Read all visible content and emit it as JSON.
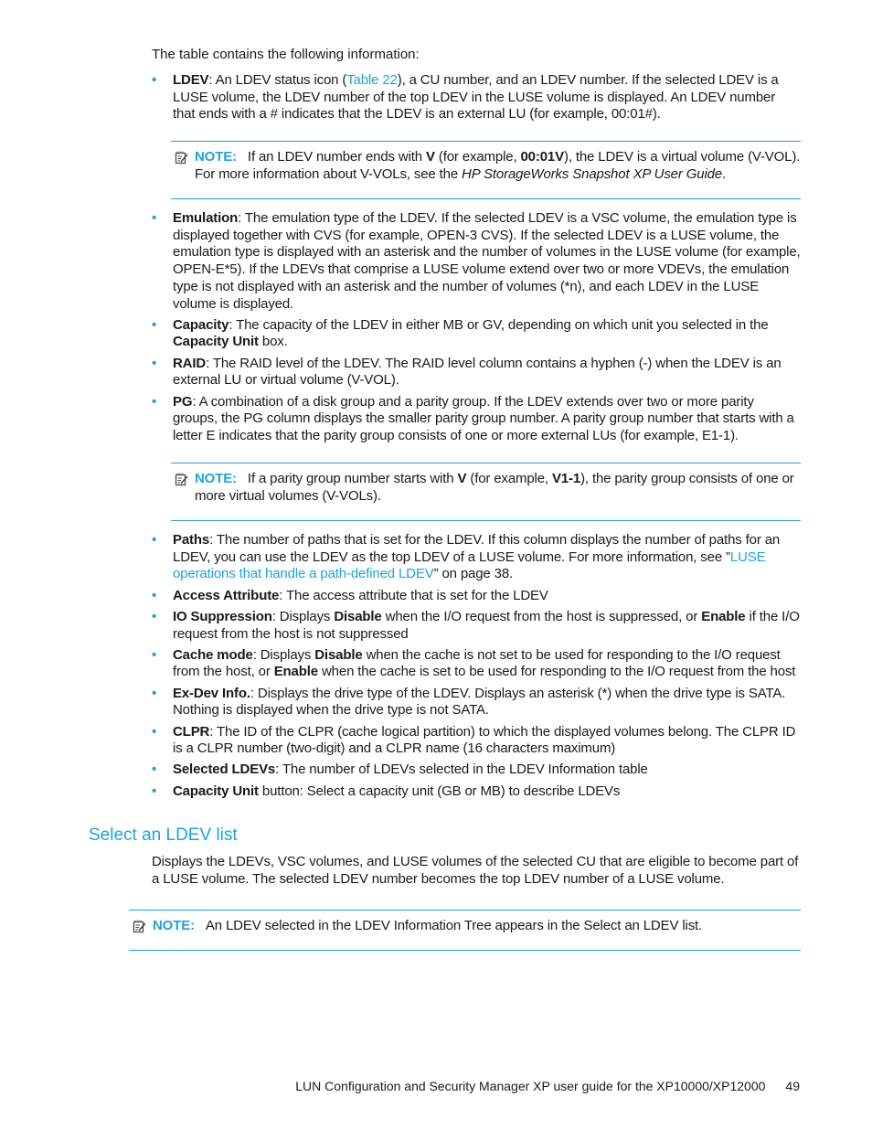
{
  "intro": "The table contains the following information:",
  "bullets_a": [
    {
      "term": "LDEV",
      "parts": [
        {
          "t": ": An LDEV status icon ("
        },
        {
          "t": "Table 22",
          "link": true
        },
        {
          "t": "), a CU number, and an LDEV number. If the selected LDEV is a LUSE volume, the LDEV number of the top LDEV in the LUSE volume is displayed. An LDEV number that ends with a # indicates that the LDEV is an external LU (for example, 00:01#)."
        }
      ]
    }
  ],
  "note1": {
    "label": "NOTE:",
    "parts": [
      {
        "t": "If an LDEV number ends with "
      },
      {
        "t": "V",
        "b": true
      },
      {
        "t": " (for example, "
      },
      {
        "t": "00:01V",
        "b": true
      },
      {
        "t": "), the LDEV is a virtual volume (V-VOL). For more information about V-VOLs, see the "
      },
      {
        "t": "HP StorageWorks Snapshot XP User Guide",
        "i": true
      },
      {
        "t": "."
      }
    ]
  },
  "bullets_b": [
    {
      "term": "Emulation",
      "parts": [
        {
          "t": ": The emulation type of the LDEV. If the selected LDEV is a VSC volume, the emulation type is displayed together with CVS (for example, OPEN-3 CVS). If the selected LDEV is a LUSE volume, the emulation type is displayed with an asterisk and the number of volumes in the LUSE volume (for example, OPEN-E*5). If the LDEVs that comprise a LUSE volume extend over two or more VDEVs, the emulation type is not displayed with an asterisk and the number of volumes (*n), and each LDEV in the LUSE volume is displayed."
        }
      ]
    },
    {
      "term": "Capacity",
      "parts": [
        {
          "t": ": The capacity of the LDEV in either MB or GV, depending on which unit you selected in the "
        },
        {
          "t": "Capacity Unit",
          "b": true
        },
        {
          "t": " box."
        }
      ]
    },
    {
      "term": "RAID",
      "parts": [
        {
          "t": ": The RAID level of the LDEV. The RAID level column contains a hyphen (-) when the LDEV is an external LU or virtual volume (V-VOL)."
        }
      ]
    },
    {
      "term": "PG",
      "parts": [
        {
          "t": ": A combination of a disk group and a parity group. If the LDEV extends over two or more parity groups, the PG column displays the smaller parity group number. A parity group number that starts with a letter E indicates that the parity group consists of one or more external LUs (for example, E1-1)."
        }
      ]
    }
  ],
  "note2": {
    "label": "NOTE:",
    "parts": [
      {
        "t": "If a parity group number starts with "
      },
      {
        "t": "V",
        "b": true
      },
      {
        "t": " (for example, "
      },
      {
        "t": "V1-1",
        "b": true
      },
      {
        "t": "), the parity group consists of one or more virtual volumes (V-VOLs)."
      }
    ]
  },
  "bullets_c": [
    {
      "term": "Paths",
      "parts": [
        {
          "t": ": The number of paths that is set for the LDEV. If this column displays the number of paths for an LDEV, you can use the LDEV as the top LDEV of a LUSE volume. For more information, see ”"
        },
        {
          "t": "LUSE operations that handle a path-defined LDEV",
          "link": true
        },
        {
          "t": "” on page 38."
        }
      ]
    },
    {
      "term": "Access Attribute",
      "parts": [
        {
          "t": ": The access attribute that is set for the LDEV"
        }
      ]
    },
    {
      "term": "IO Suppression",
      "parts": [
        {
          "t": ": Displays "
        },
        {
          "t": "Disable",
          "b": true
        },
        {
          "t": " when the I/O request from the host is suppressed, or "
        },
        {
          "t": "Enable",
          "b": true
        },
        {
          "t": " if the I/O request from the host is not suppressed"
        }
      ]
    },
    {
      "term": "Cache mode",
      "parts": [
        {
          "t": ": Displays "
        },
        {
          "t": "Disable",
          "b": true
        },
        {
          "t": " when the cache is not set to be used for responding to the I/O request from the host, or "
        },
        {
          "t": "Enable",
          "b": true
        },
        {
          "t": " when the cache is set to be used for responding to the I/O request from the host"
        }
      ]
    },
    {
      "term": "Ex-Dev Info.",
      "parts": [
        {
          "t": ": Displays the drive type of the LDEV. Displays an asterisk (*) when the drive type is SATA. Nothing is displayed when the drive type is not SATA."
        }
      ]
    },
    {
      "term": "CLPR",
      "parts": [
        {
          "t": ": The ID of the CLPR (cache logical partition) to which the displayed volumes belong. The CLPR ID is a CLPR number (two-digit) and a CLPR name (16 characters maximum)"
        }
      ]
    },
    {
      "term": "Selected LDEVs",
      "parts": [
        {
          "t": ": The number of LDEVs selected in the LDEV Information table"
        }
      ]
    },
    {
      "term": "Capacity Unit",
      "parts": [
        {
          "t": " button: Select a capacity unit (GB or MB) to describe LDEVs"
        }
      ]
    }
  ],
  "section": {
    "title": "Select an LDEV list",
    "body": "Displays the LDEVs, VSC volumes, and LUSE volumes of the selected CU that are eligible to become part of a LUSE volume. The selected LDEV number becomes the top LDEV number of a LUSE volume."
  },
  "note3": {
    "label": "NOTE:",
    "parts": [
      {
        "t": "An LDEV selected in the LDEV Information Tree appears in the Select an LDEV list."
      }
    ]
  },
  "footer": {
    "title": "LUN Configuration and Security Manager XP user guide for the XP10000/XP12000",
    "page": "49"
  },
  "colors": {
    "accent": "#1fa3d9",
    "text": "#1a1a1a"
  }
}
